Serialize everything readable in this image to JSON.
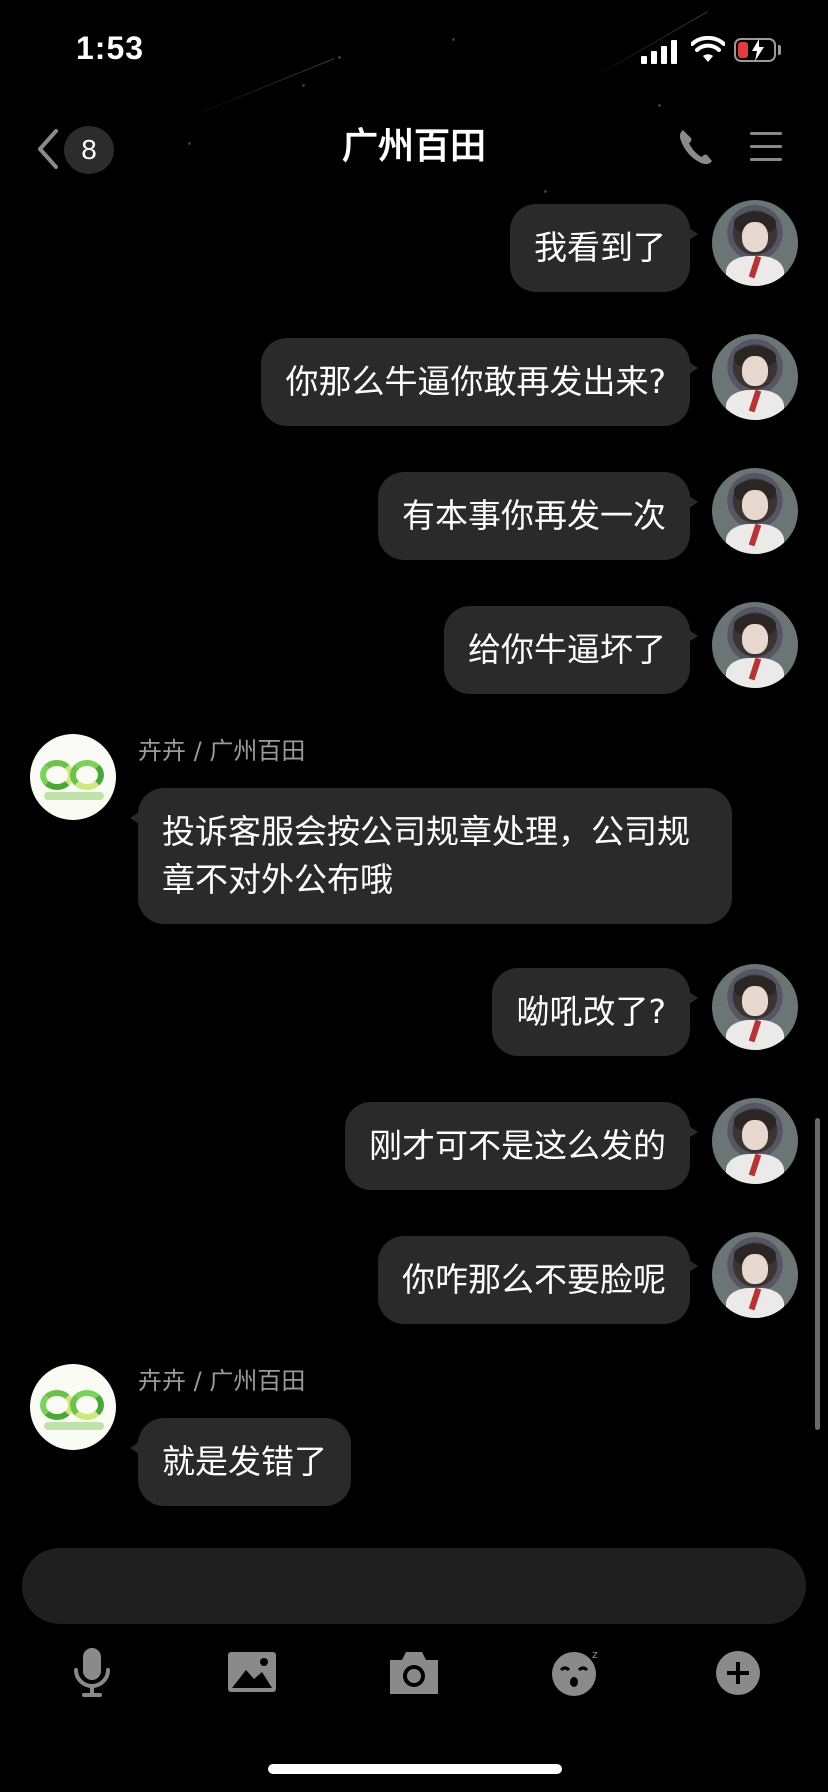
{
  "status_bar": {
    "time": "1:53"
  },
  "nav": {
    "unread_count": "8",
    "title": "广州百田"
  },
  "messages": [
    {
      "side": "out",
      "text": "我看到了"
    },
    {
      "side": "out",
      "text": "你那么牛逼你敢再发出来?"
    },
    {
      "side": "out",
      "text": "有本事你再发一次"
    },
    {
      "side": "out",
      "text": "给你牛逼坏了"
    },
    {
      "side": "in",
      "sender": "卉卉 / 广州百田",
      "text": "投诉客服会按公司规章处理，公司规章不对外公布哦"
    },
    {
      "side": "out",
      "text": "呦吼改了?"
    },
    {
      "side": "out",
      "text": "刚才可不是这么发的"
    },
    {
      "side": "out",
      "text": "你咋那么不要脸呢"
    },
    {
      "side": "in",
      "sender": "卉卉 / 广州百田",
      "text": "就是发错了"
    }
  ],
  "input": {
    "value": ""
  },
  "toolbar": {
    "icons": [
      "microphone-icon",
      "image-icon",
      "camera-icon",
      "sticker-icon",
      "plus-icon"
    ]
  },
  "colors": {
    "background": "#000000",
    "bubble": "#2a2a2a",
    "sender_text": "#9a9a9a",
    "battery_low": "#e33b3b"
  }
}
